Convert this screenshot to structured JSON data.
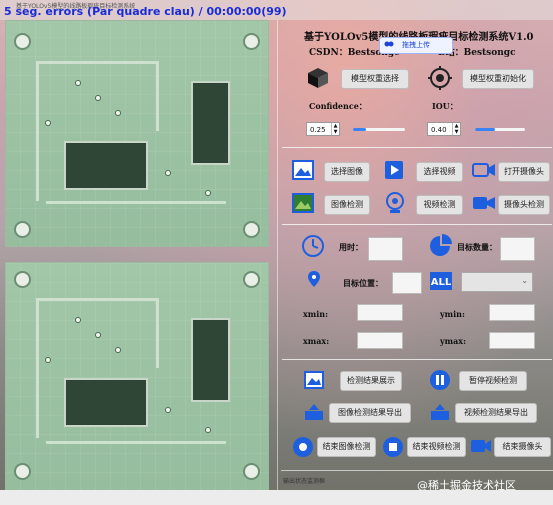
{
  "window": {
    "overlay_text": "5 seg. errors (Par quadre clau) / 00:00:00(99)",
    "title_small": "基于YOLOv5模型的线路板瑕疵目标检测系统"
  },
  "header": {
    "title": "基于YOLOv5模型的线路板瑕疵目标检测系统V1.0",
    "csdn": "CSDN：Bestsongc",
    "bilibili": "B站：Bestsongc",
    "upload_label": "拖拽上传"
  },
  "model": {
    "select_label": "模型权重选择",
    "init_label": "模型权重初始化"
  },
  "params": {
    "confidence_label": "Confidence：",
    "confidence_value": "0.25",
    "confidence_fraction": 0.25,
    "iou_label": "IOU：",
    "iou_value": "0.40",
    "iou_fraction": 0.4
  },
  "actions": {
    "select_image": "选择图像",
    "select_video": "选择视频",
    "open_camera": "打开摄像头",
    "image_detect": "图像检测",
    "video_detect": "视频检测",
    "camera_detect": "摄像头检测"
  },
  "info": {
    "time_label": "用时：",
    "count_label": "目标数量：",
    "position_label": "目标位置：",
    "xmin_label": "xmin:",
    "ymin_label": "ymin:",
    "xmax_label": "xmax:",
    "ymax_label": "ymax:"
  },
  "results": {
    "show_result": "检测结果展示",
    "pause_video": "暂停视频检测",
    "export_image": "图像检测结果导出",
    "export_video": "视频检测结果导出",
    "end_image": "结束图像检测",
    "end_video": "结束视频检测",
    "end_camera": "结束摄像头"
  },
  "status": {
    "text": "输出状态监测框"
  },
  "watermark": "@稀土掘金技术社区",
  "colors": {
    "accent": "#3b82f6",
    "icon_blue": "#1e5fe0"
  }
}
